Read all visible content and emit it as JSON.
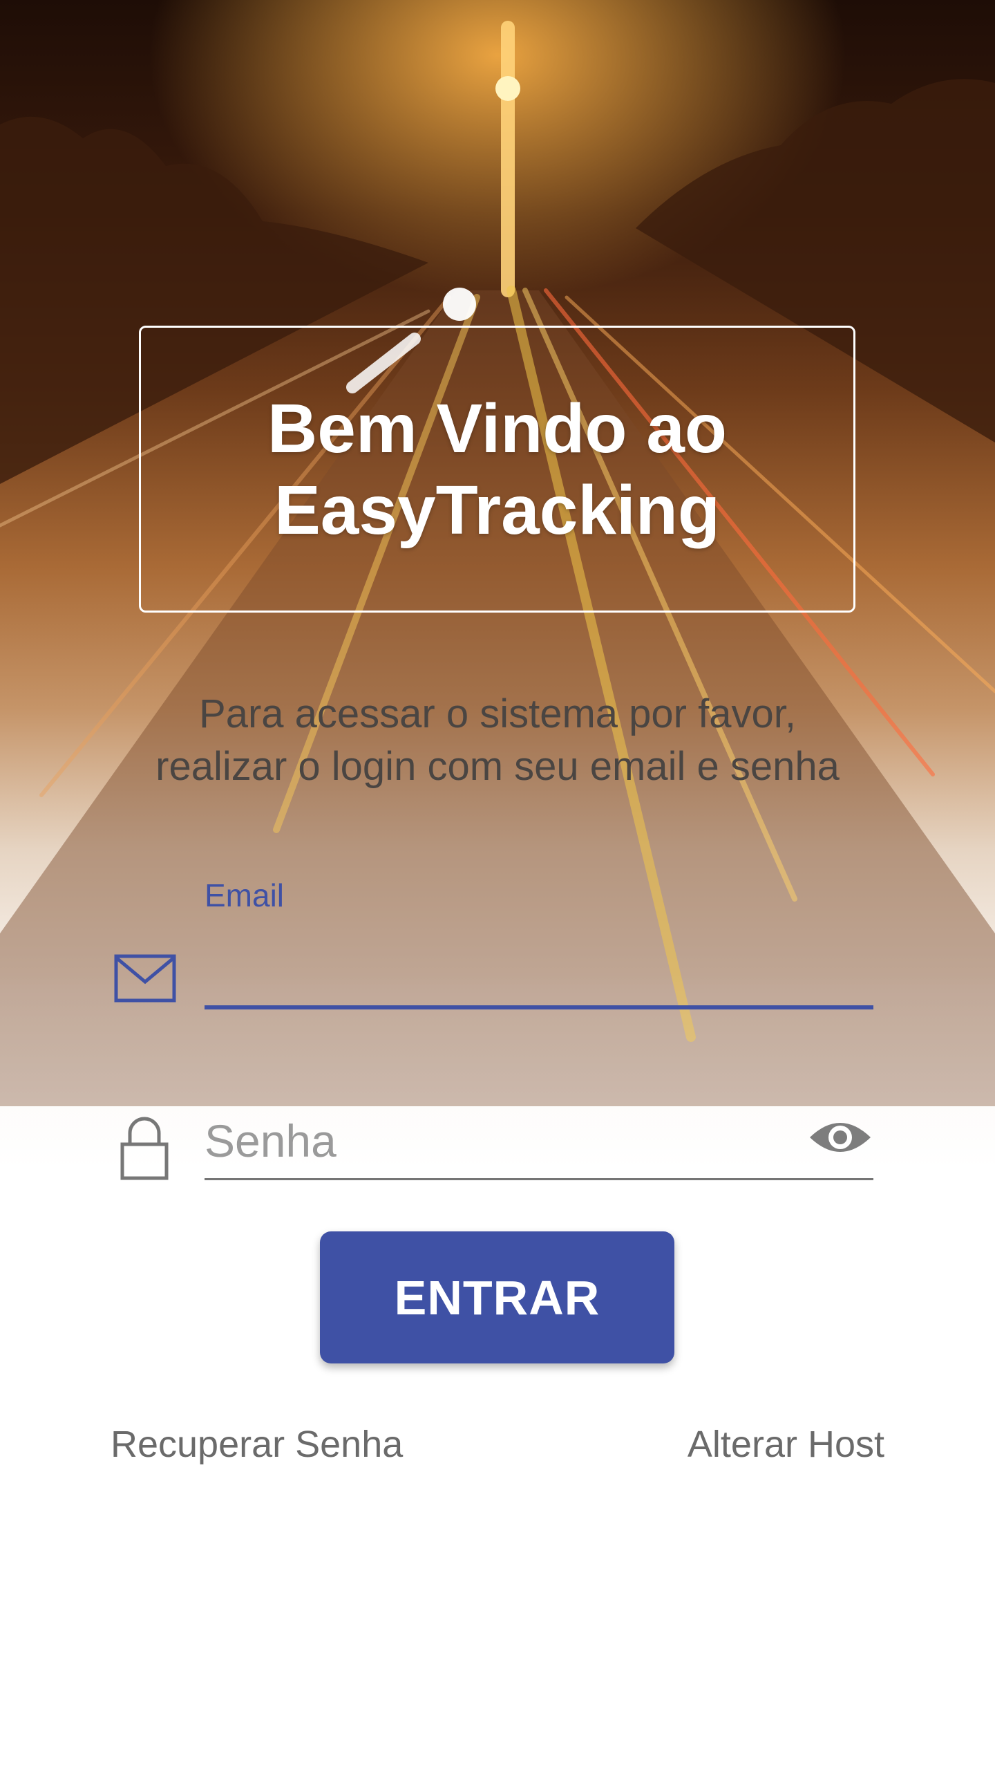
{
  "welcome": {
    "line1": "Bem Vindo ao",
    "line2": "EasyTracking"
  },
  "intro": {
    "line1": "Para acessar o sistema por favor,",
    "line2": "realizar o login com seu email e senha"
  },
  "email_field": {
    "label": "Email",
    "value": "",
    "icon": "envelope-icon"
  },
  "password_field": {
    "placeholder": "Senha",
    "value": "",
    "icon": "lock-icon",
    "toggle_icon": "eye-icon"
  },
  "enter_button": {
    "label": "ENTRAR"
  },
  "links": {
    "recover": "Recuperar Senha",
    "change_host": "Alterar Host"
  },
  "colors": {
    "primary": "#3f51a5",
    "background_top": "#2a1308",
    "background_glow": "#b86a2c",
    "link": "#6a6a6a"
  }
}
